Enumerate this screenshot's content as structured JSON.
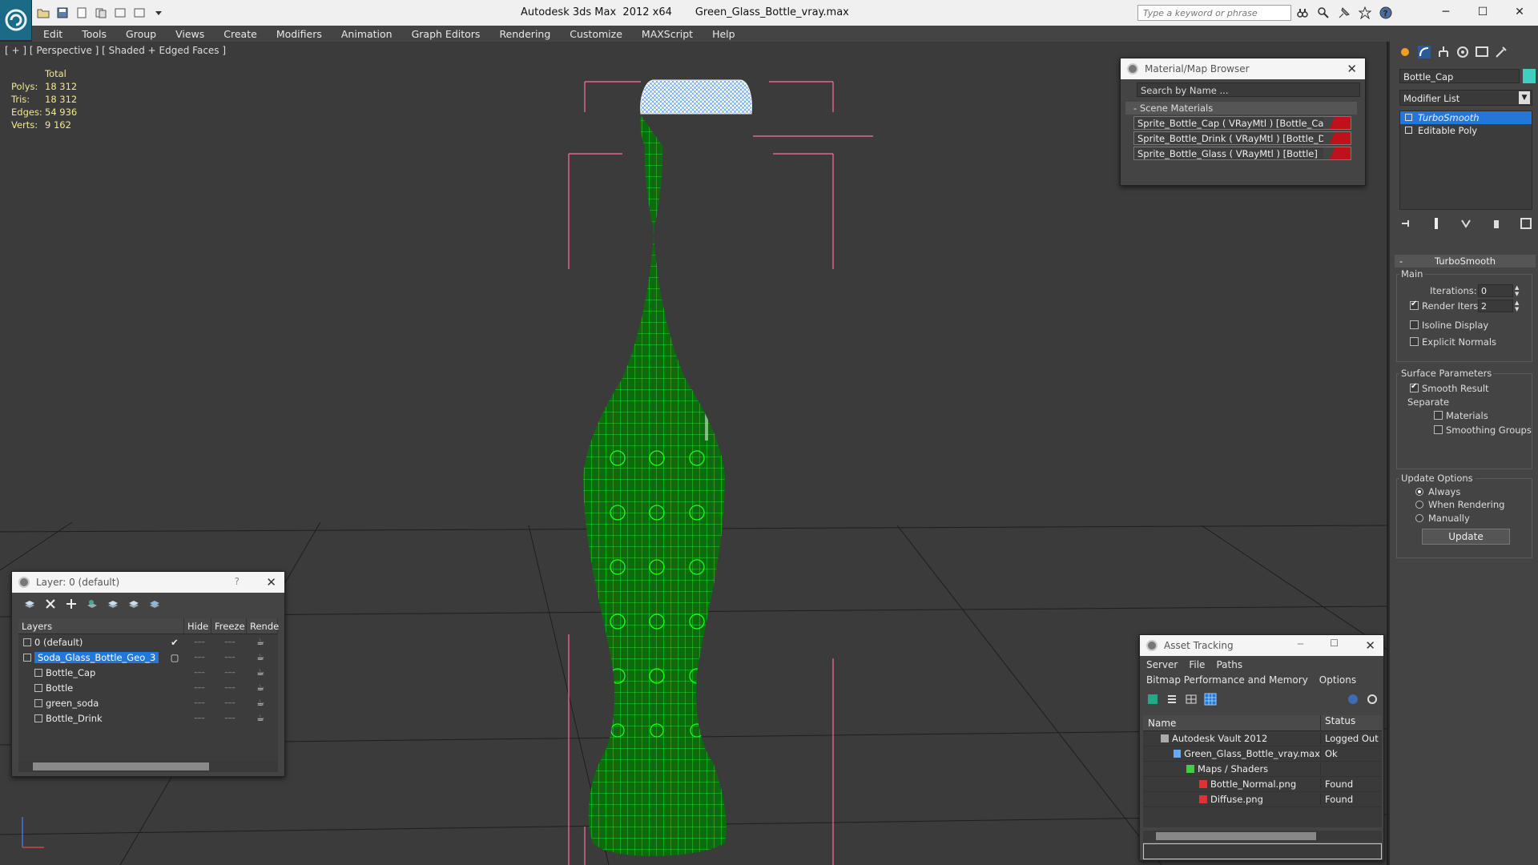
{
  "window": {
    "title": "Autodesk 3ds Max  2012 x64       Green_Glass_Bottle_vray.max",
    "search_placeholder": "Type a keyword or phrase"
  },
  "menu": [
    "Edit",
    "Tools",
    "Group",
    "Views",
    "Create",
    "Modifiers",
    "Animation",
    "Graph Editors",
    "Rendering",
    "Customize",
    "MAXScript",
    "Help"
  ],
  "viewport": {
    "label": "[ + ] [ Perspective ] [ Shaded + Edged Faces ]",
    "stats_header": "Total",
    "stats": [
      {
        "k": "Polys:",
        "v": "18 312"
      },
      {
        "k": "Tris:",
        "v": "18 312"
      },
      {
        "k": "Edges:",
        "v": "54 936"
      },
      {
        "k": "Verts:",
        "v": "9 162"
      }
    ]
  },
  "material_browser": {
    "title": "Material/Map Browser",
    "search_placeholder": "Search by Name ...",
    "section": "Scene Materials",
    "items": [
      "Sprite_Bottle_Cap  ( VRayMtl ) [Bottle_Cap]",
      "Sprite_Bottle_Drink  ( VRayMtl ) [Bottle_Drink]",
      "Sprite_Bottle_Glass  ( VRayMtl ) [Bottle]"
    ],
    "swatch_color": "#c0101a"
  },
  "layer_panel": {
    "title": "Layer: 0 (default)",
    "help": "?",
    "columns": [
      "Layers",
      "Hide",
      "Freeze",
      "Rende"
    ],
    "rows": [
      {
        "name": "0 (default)",
        "indent": 1,
        "selected": false,
        "mark": "✔"
      },
      {
        "name": "Soda_Glass_Bottle_Geo_3",
        "indent": 1,
        "selected": true,
        "mark": "▢"
      },
      {
        "name": "Bottle_Cap",
        "indent": 2,
        "selected": false,
        "mark": ""
      },
      {
        "name": "Bottle",
        "indent": 2,
        "selected": false,
        "mark": ""
      },
      {
        "name": "green_soda",
        "indent": 2,
        "selected": false,
        "mark": ""
      },
      {
        "name": "Bottle_Drink",
        "indent": 2,
        "selected": false,
        "mark": ""
      }
    ],
    "dash": "–––"
  },
  "asset_tracking": {
    "title": "Asset Tracking",
    "menu1": [
      "Server",
      "File",
      "Paths"
    ],
    "menu2": [
      "Bitmap Performance and Memory",
      "Options"
    ],
    "columns": [
      "Name",
      "Status"
    ],
    "rows": [
      {
        "name": "Autodesk Vault 2012",
        "status": "Logged Out",
        "indent": 1
      },
      {
        "name": "Green_Glass_Bottle_vray.max",
        "status": "Ok",
        "indent": 2
      },
      {
        "name": "Maps / Shaders",
        "status": "",
        "indent": 3
      },
      {
        "name": "Bottle_Normal.png",
        "status": "Found",
        "indent": 4
      },
      {
        "name": "Diffuse.png",
        "status": "Found",
        "indent": 4
      }
    ]
  },
  "command_panel": {
    "object_name": "Bottle_Cap",
    "object_color": "#3ecfc0",
    "modifier_list": "Modifier List",
    "stack": [
      "TurboSmooth",
      "Editable Poly"
    ],
    "rollout_title": "TurboSmooth",
    "main_label": "Main",
    "iterations_label": "Iterations:",
    "iterations_value": "0",
    "render_iters_label": "Render Iters:",
    "render_iters_value": "2",
    "isoline_label": "Isoline Display",
    "explicit_normals_label": "Explicit Normals",
    "surface_params_label": "Surface Parameters",
    "smooth_result_label": "Smooth Result",
    "separate_label": "Separate",
    "materials_label": "Materials",
    "smoothing_groups_label": "Smoothing Groups",
    "update_options_label": "Update Options",
    "always_label": "Always",
    "when_rendering_label": "When Rendering",
    "manually_label": "Manually",
    "update_button": "Update"
  },
  "colors": {
    "wire_green": "#1aff1a",
    "bottle_fill": "#0d6b0d",
    "bbox_pink": "#ff6fa0",
    "selection_blue": "#2277d8"
  }
}
